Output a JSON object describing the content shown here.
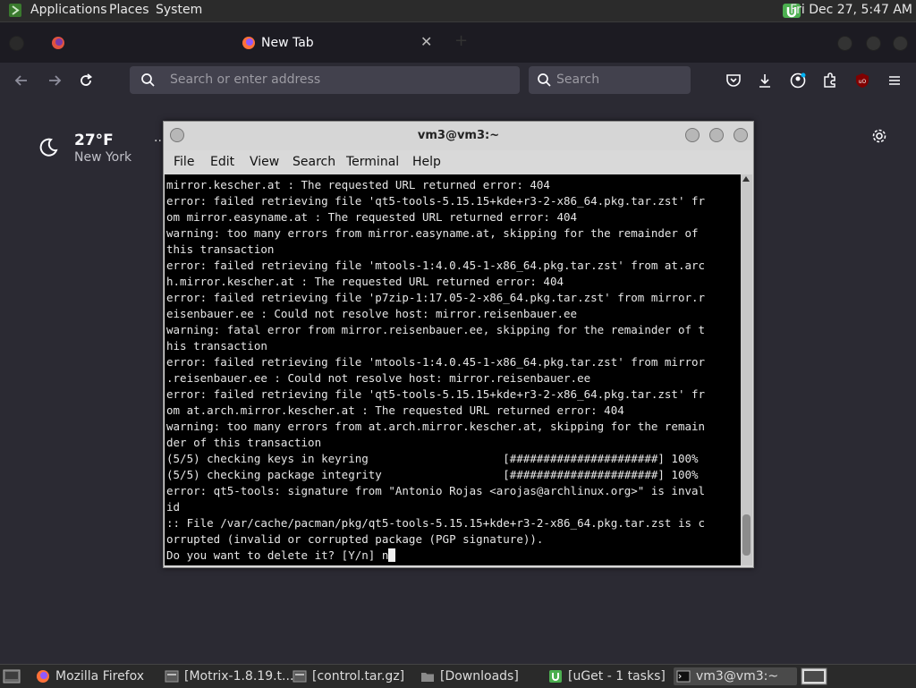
{
  "top_panel": {
    "menus": [
      "Applications",
      "Places",
      "System"
    ],
    "clock": "Fri Dec 27,  5:47 AM"
  },
  "browser": {
    "active_tab_label": "New Tab",
    "url_placeholder": "Search or enter address",
    "search_placeholder": "Search",
    "weather": {
      "temp": "27°F",
      "city": "New York",
      "menu": "··"
    }
  },
  "terminal": {
    "title": "vm3@vm3:~",
    "menu": [
      "File",
      "Edit",
      "View",
      "Search",
      "Terminal",
      "Help"
    ],
    "lines": [
      "mirror.kescher.at : The requested URL returned error: 404",
      "error: failed retrieving file 'qt5-tools-5.15.15+kde+r3-2-x86_64.pkg.tar.zst' fr",
      "om mirror.easyname.at : The requested URL returned error: 404",
      "warning: too many errors from mirror.easyname.at, skipping for the remainder of",
      "this transaction",
      "error: failed retrieving file 'mtools-1:4.0.45-1-x86_64.pkg.tar.zst' from at.arc",
      "h.mirror.kescher.at : The requested URL returned error: 404",
      "error: failed retrieving file 'p7zip-1:17.05-2-x86_64.pkg.tar.zst' from mirror.r",
      "eisenbauer.ee : Could not resolve host: mirror.reisenbauer.ee",
      "warning: fatal error from mirror.reisenbauer.ee, skipping for the remainder of t",
      "his transaction",
      "error: failed retrieving file 'mtools-1:4.0.45-1-x86_64.pkg.tar.zst' from mirror",
      ".reisenbauer.ee : Could not resolve host: mirror.reisenbauer.ee",
      "error: failed retrieving file 'qt5-tools-5.15.15+kde+r3-2-x86_64.pkg.tar.zst' fr",
      "om at.arch.mirror.kescher.at : The requested URL returned error: 404",
      "warning: too many errors from at.arch.mirror.kescher.at, skipping for the remain",
      "der of this transaction",
      "(5/5) checking keys in keyring                    [######################] 100%",
      "(5/5) checking package integrity                  [######################] 100%",
      "error: qt5-tools: signature from \"Antonio Rojas <arojas@archlinux.org>\" is inval",
      "id",
      ":: File /var/cache/pacman/pkg/qt5-tools-5.15.15+kde+r3-2-x86_64.pkg.tar.zst is c",
      "orrupted (invalid or corrupted package (PGP signature)).",
      "Do you want to delete it? [Y/n] n"
    ]
  },
  "taskbar": {
    "items": [
      {
        "label": "Mozilla Firefox",
        "icon": "firefox-icon"
      },
      {
        "label": "[Motrix-1.8.19.t...",
        "icon": "motrix-icon"
      },
      {
        "label": "[control.tar.gz]",
        "icon": "file-icon"
      },
      {
        "label": "[Downloads]",
        "icon": "folder-icon"
      },
      {
        "label": "[uGet - 1 tasks]",
        "icon": "uget-icon"
      },
      {
        "label": "vm3@vm3:~",
        "icon": "terminal-icon"
      }
    ]
  }
}
